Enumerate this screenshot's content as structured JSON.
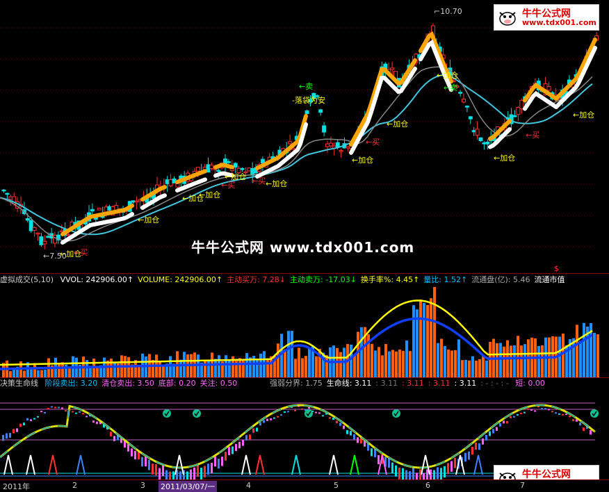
{
  "price_pane": {
    "high_label": "10.70",
    "watermark": "牛牛公式网 www.tdx001.com",
    "annotations": [
      {
        "text": "←加仓",
        "color": "#ffff00",
        "type": "add"
      },
      {
        "text": "←买",
        "color": "#ff3030",
        "type": "buy"
      },
      {
        "text": "←7.50",
        "color": "#cccccc",
        "type": "low"
      },
      {
        "text": "←加仓",
        "color": "#ffff00",
        "type": "add"
      },
      {
        "text": "←加仓",
        "color": "#ffff00",
        "type": "add"
      },
      {
        "text": "←加仓",
        "color": "#ffff00",
        "type": "add"
      },
      {
        "text": "←加仓",
        "color": "#ffff00",
        "type": "add"
      },
      {
        "text": "←买",
        "color": "#ff3030",
        "type": "buy"
      },
      {
        "text": "←加仓",
        "color": "#ffff00",
        "type": "add"
      },
      {
        "text": "←买",
        "color": "#ff3030",
        "type": "buy"
      },
      {
        "text": "←卖",
        "color": "#00ff00",
        "type": "sell"
      },
      {
        "text": "-落袋为安",
        "color": "#ffff00",
        "type": "note"
      },
      {
        "text": "←加仓",
        "color": "#ffff00",
        "type": "add"
      },
      {
        "text": "←买",
        "color": "#ff3030",
        "type": "buy"
      },
      {
        "text": "←加仓",
        "color": "#ffff00",
        "type": "add"
      },
      {
        "text": "←加仓",
        "color": "#ffff00",
        "type": "add"
      },
      {
        "text": "←卖",
        "color": "#00ff00",
        "type": "sell"
      },
      {
        "text": "←加仓",
        "color": "#ffff00",
        "type": "add"
      },
      {
        "text": "←买",
        "color": "#ff3030",
        "type": "buy"
      },
      {
        "text": "←加仓",
        "color": "#ffff00",
        "type": "add"
      },
      {
        "text": "$",
        "color": "#ff3030",
        "type": "mark"
      }
    ]
  },
  "logo": {
    "line1": "牛牛公式网",
    "line2": "www.tdx001.com"
  },
  "volume_pane": {
    "title": "虚拟成交(5,10)",
    "fields": [
      {
        "label": "VVOL:",
        "value": "242906.00",
        "color": "#ffffff",
        "arrow": "↑"
      },
      {
        "label": "VOLUME:",
        "value": "242906.00",
        "color": "#ffff00",
        "arrow": "↑"
      },
      {
        "label": "主动买万:",
        "value": "7.28",
        "color": "#ff3030",
        "arrow": "↓"
      },
      {
        "label": "主动卖万:",
        "value": "-17.03",
        "color": "#00ff00",
        "arrow": "↓"
      },
      {
        "label": "换手率%:",
        "value": "4.45",
        "color": "#ffff00",
        "arrow": "↑"
      },
      {
        "label": "量比:",
        "value": "1.52",
        "color": "#00bfff",
        "arrow": "↑"
      },
      {
        "label": "流通盘(亿):",
        "value": "5.46",
        "color": "#aaaaaa",
        "arrow": ""
      },
      {
        "label": "流通市值",
        "value": "",
        "color": "#ffffff",
        "arrow": ""
      }
    ]
  },
  "decision_pane": {
    "title": "决策生命线",
    "fields_left": [
      {
        "label": "阶段卖出:",
        "value": "3.20",
        "color": "#00bfff"
      },
      {
        "label": "清仓卖出:",
        "value": "3.50",
        "color": "#ff66ff"
      },
      {
        "label": "底部:",
        "value": "0.20",
        "color": "#ff66ff"
      },
      {
        "label": "关注:",
        "value": "0.50",
        "color": "#ff66ff"
      }
    ],
    "fields_right": [
      {
        "label": "强弱分界:",
        "value": "1.75",
        "color": "#aaaaaa"
      },
      {
        "label": "生命线:",
        "value": "3.11",
        "color": "#ffffff"
      },
      {
        "label": ":",
        "value": "3.11",
        "color": "#777777"
      },
      {
        "label": ":",
        "value": "3.11",
        "color": "#ff3030"
      },
      {
        "label": ":",
        "value": "3.11",
        "color": "#ff3030"
      },
      {
        "label": ":",
        "value": "3.11",
        "color": "#ffffff"
      },
      {
        "label": ": - : - : -",
        "value": "",
        "color": "#777777"
      },
      {
        "label": "短:",
        "value": "0.00",
        "color": "#ff66ff"
      }
    ]
  },
  "time_axis": {
    "ticks": [
      "2011年",
      "2",
      "3",
      "2011/03/07/一",
      "4",
      "5",
      "6",
      "7"
    ],
    "selected_index": 3
  }
}
